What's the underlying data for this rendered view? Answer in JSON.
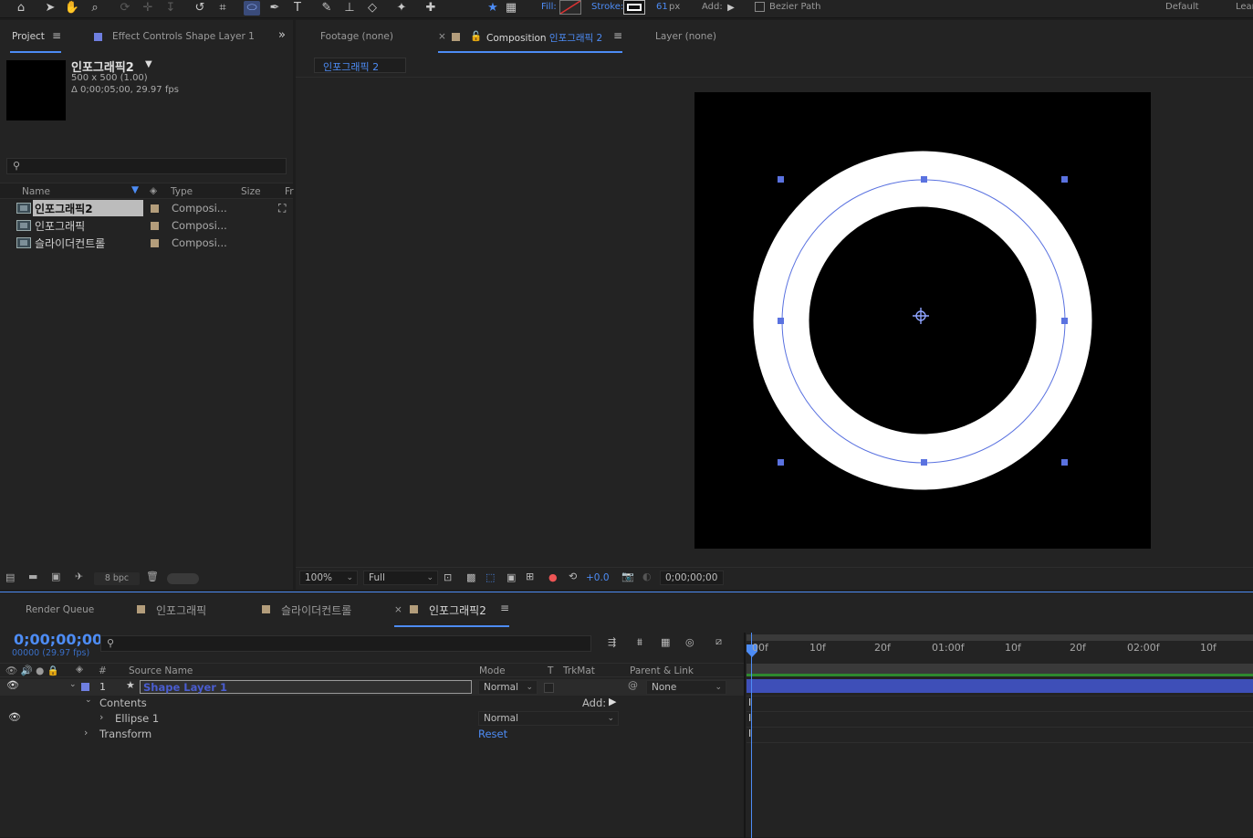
{
  "toolbar": {
    "fill_label": "Fill:",
    "stroke_label": "Stroke:",
    "stroke_width": "61",
    "stroke_unit": "px",
    "add_label": "Add:",
    "bezier_label": "Bezier Path",
    "workspace_default": "Default",
    "workspace_learn": "Lear"
  },
  "project_panel": {
    "tab_label": "Project",
    "effect_controls_label": "Effect Controls",
    "effect_controls_layer": "Shape Layer 1",
    "selected_comp_name": "인포그래픽2",
    "selected_comp_size": "500 x 500 (1.00)",
    "selected_comp_duration": "Δ 0;00;05;00, 29.97 fps",
    "columns": {
      "name": "Name",
      "type": "Type",
      "size": "Size",
      "fr": "Fr"
    },
    "items": [
      {
        "name": "인포그래픽2",
        "type": "Composi..."
      },
      {
        "name": "인포그래픽",
        "type": "Composi..."
      },
      {
        "name": "슬라이더컨트롤",
        "type": "Composi..."
      }
    ],
    "bpc": "8 bpc"
  },
  "viewer": {
    "footage_tab": "Footage  (none)",
    "composition_label": "Composition",
    "composition_name": "인포그래픽 2",
    "layer_tab": "Layer  (none)",
    "breadcrumb": "인포그래픽 2",
    "zoom": "100%",
    "resolution": "Full",
    "exposure": "+0.0",
    "timecode": "0;00;00;00"
  },
  "timeline": {
    "render_queue_tab": "Render Queue",
    "tabs": [
      "인포그래픽",
      "슬라이더컨트롤",
      "인포그래픽2"
    ],
    "current_time": "0;00;00;00",
    "frame_info": "00000 (29.97 fps)",
    "columns": {
      "num": "#",
      "source_name": "Source Name",
      "mode": "Mode",
      "t": "T",
      "trkmat": "TrkMat",
      "parent": "Parent & Link"
    },
    "layer": {
      "index": "1",
      "name": "Shape Layer 1",
      "mode": "Normal",
      "parent": "None"
    },
    "contents_label": "Contents",
    "add_label": "Add:",
    "ellipse_label": "Ellipse 1",
    "ellipse_mode": "Normal",
    "transform_label": "Transform",
    "reset_label": "Reset",
    "ruler_labels": [
      "00f",
      "10f",
      "20f",
      "01:00f",
      "10f",
      "20f",
      "02:00f",
      "10f"
    ]
  },
  "colors": {
    "accent_blue": "#4d8cf5",
    "label_tan": "#b39d7b",
    "layer_bar": "#3e4fb8",
    "ring_fill": "#ffffff",
    "comp_bg": "#000000"
  }
}
